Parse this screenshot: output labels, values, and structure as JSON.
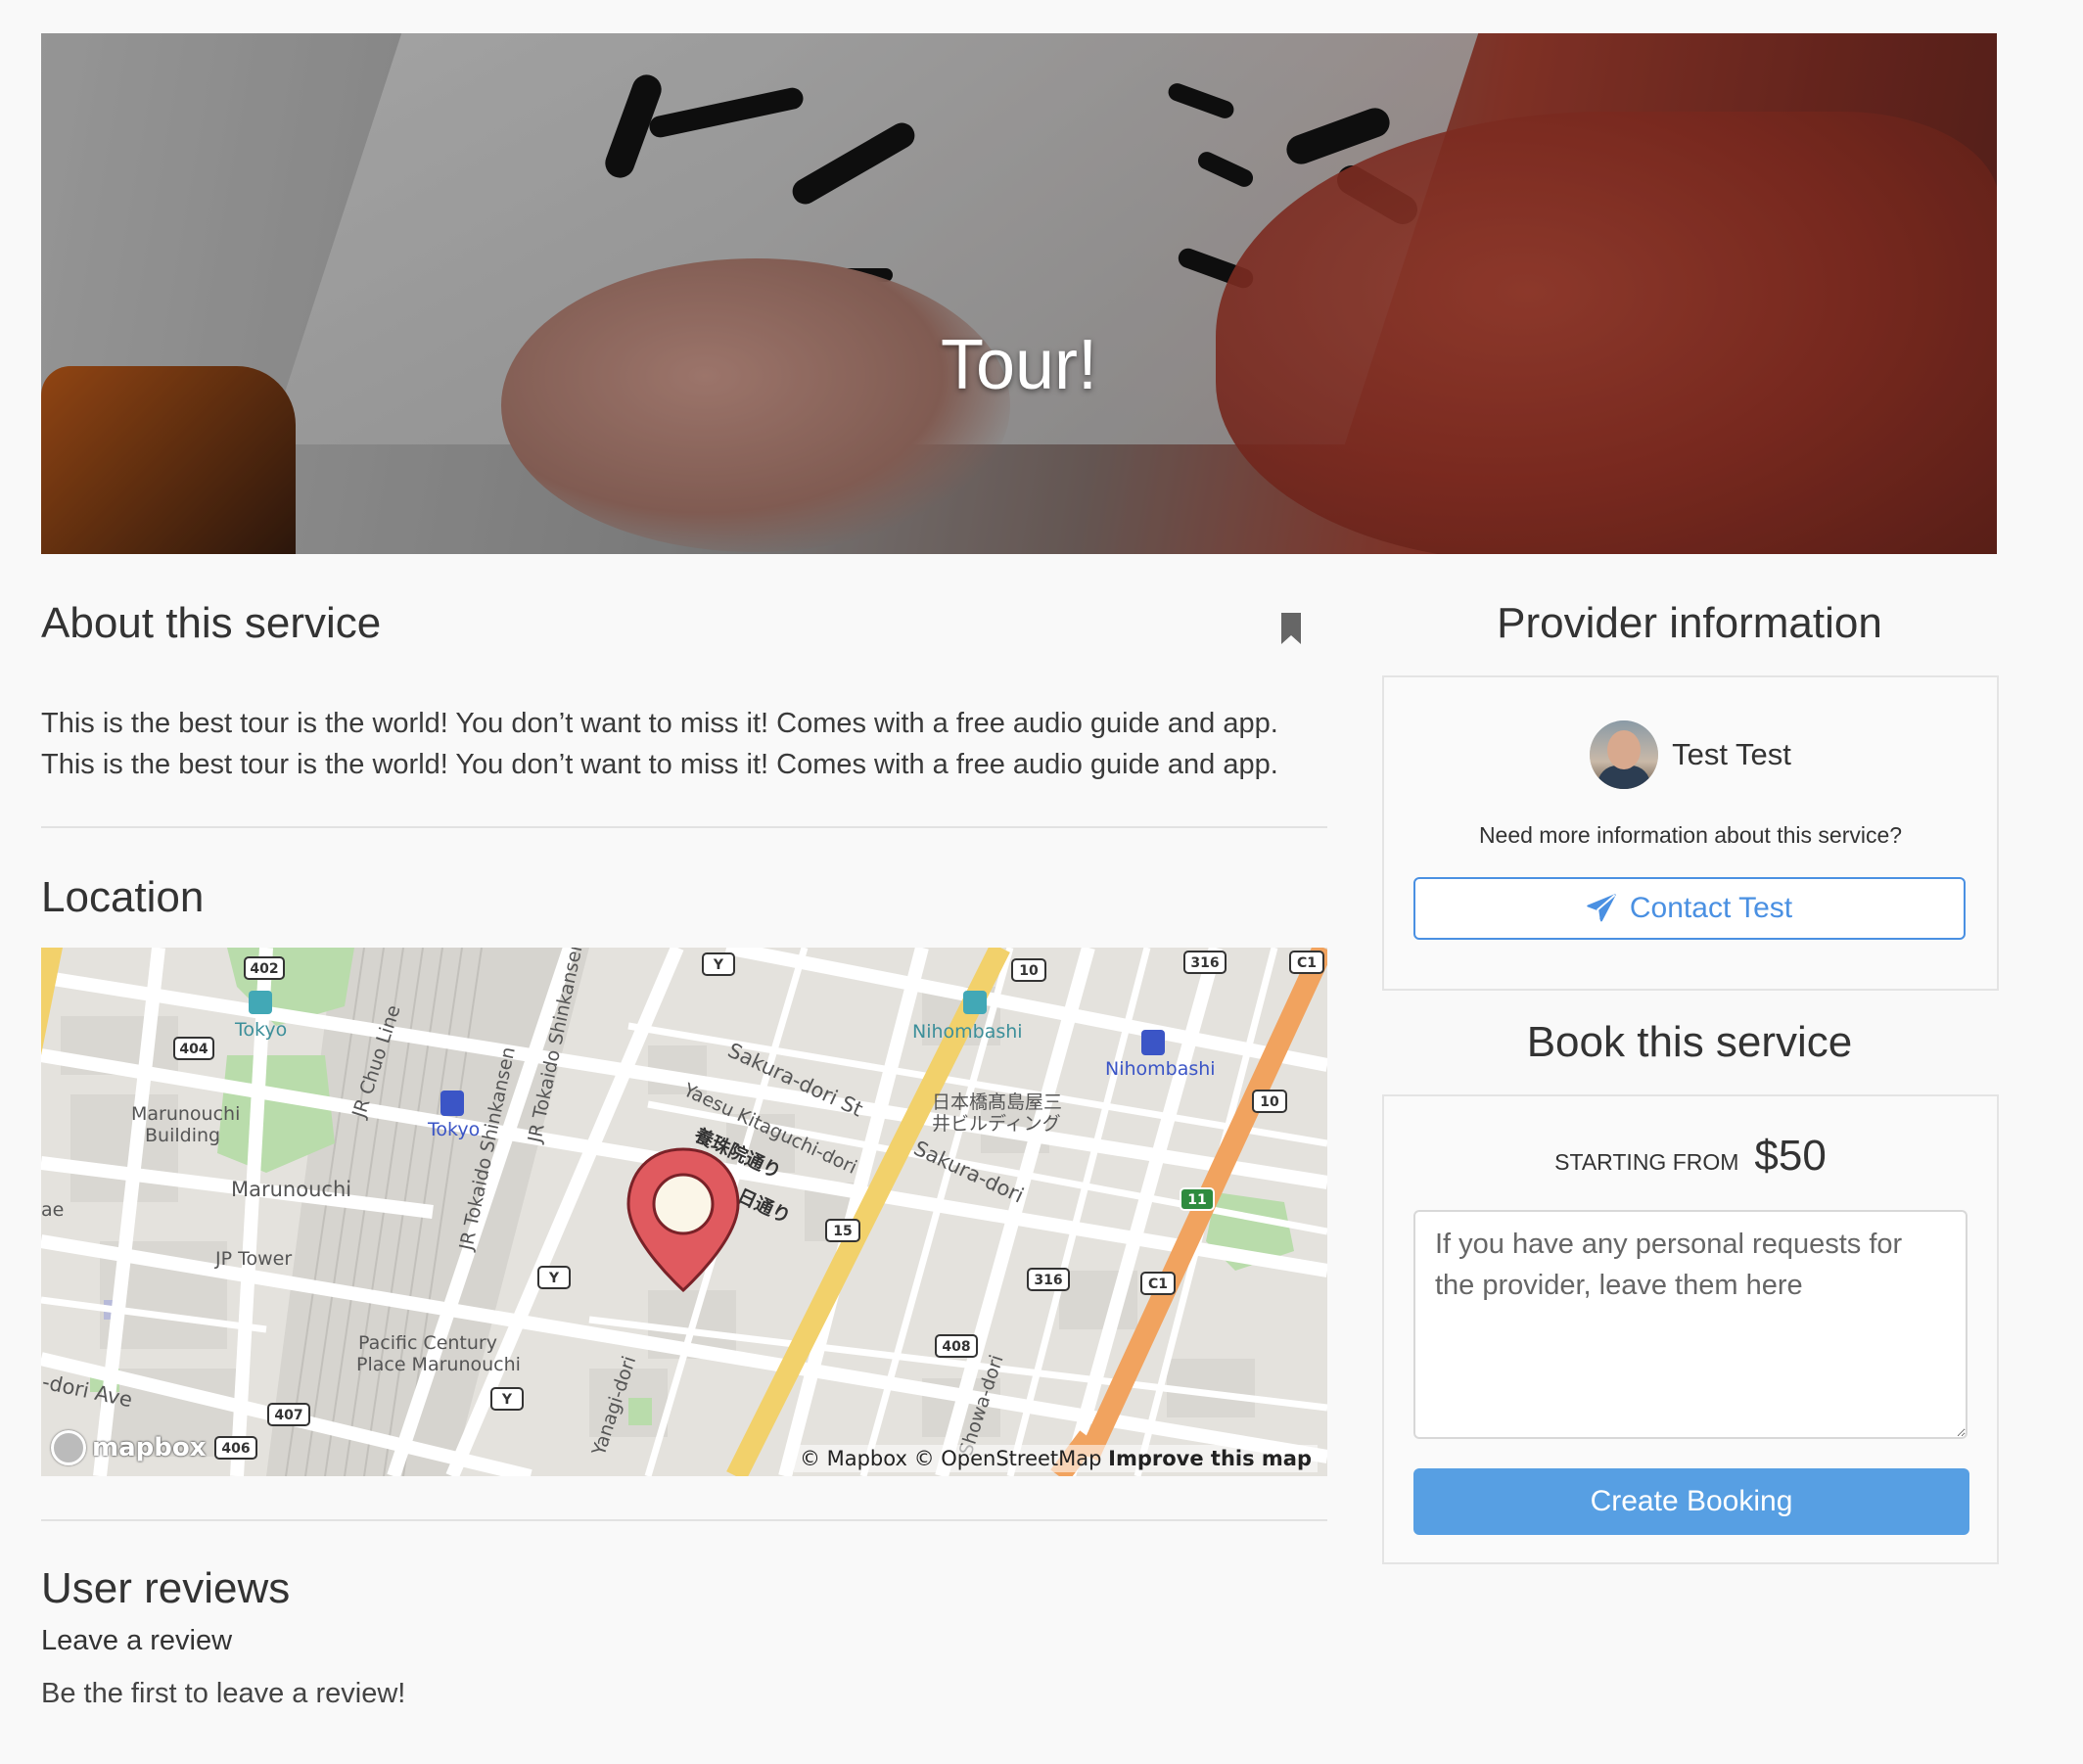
{
  "hero": {
    "title": "Tour!"
  },
  "about": {
    "heading": "About this service",
    "paragraphs": [
      "This is the best tour is the world! You don’t want to miss it! Comes with a free audio guide and app.",
      "This is the best tour is the world! You don’t want to miss it! Comes with a free audio guide and app."
    ]
  },
  "location": {
    "heading": "Location",
    "map": {
      "attribution": "© Mapbox © OpenStreetMap",
      "improve": "Improve this map",
      "logo": "mapbox",
      "labels": {
        "tokyo_station_metro": "Tokyo",
        "marunouchi_building": "Marunouchi",
        "marunouchi_building2": "Building",
        "marunouchi": "Marunouchi",
        "jp_tower": "JP Tower",
        "jr_chuo": "JR Chuo Line",
        "tokyo_jr": "Tokyo",
        "jr_tokaido_shinkansen1": "JR Tokaido Shinkansen",
        "jr_tokaido_shinkansen2": "JR Tokaido Shinkansen",
        "sakura_dori_st": "Sakura-dori St",
        "yaesu": "Yaesu Kitaguchi-dori",
        "yojuin": "養珠院通り",
        "nichi": "日通り",
        "nihombashi_metro": "Nihombashi",
        "nihombashi_jr": "Nihombashi",
        "takashimaya1": "日本橋髙島屋三",
        "takashimaya2": "井ビルディング",
        "sakura_dori": "Sakura-dori",
        "dori_ave": "-dori Ave",
        "pacific1": "Pacific Century",
        "pacific2": "Place Marunouchi",
        "yanagi": "Yanagi-dori",
        "showa": "Showa-dori",
        "ae": "ae"
      },
      "shields": [
        "402",
        "404",
        "Y",
        "10",
        "316",
        "C1",
        "10",
        "15",
        "Y",
        "Y",
        "316",
        "C1",
        "11",
        "408",
        "407",
        "406"
      ]
    }
  },
  "reviews": {
    "heading": "User reviews",
    "leave": "Leave a review",
    "empty": "Be the first to leave a review!"
  },
  "provider": {
    "heading": "Provider information",
    "name": "Test Test",
    "question": "Need more information about this service?",
    "contact_label": "Contact Test"
  },
  "booking": {
    "heading": "Book this service",
    "starting_from": "STARTING FROM",
    "price": "$50",
    "requests_placeholder": "If you have any personal requests for the provider, leave them here",
    "create_label": "Create Booking"
  },
  "colors": {
    "accent": "#4a90e2",
    "button": "#579fe3",
    "pin": "#e05a5f"
  }
}
